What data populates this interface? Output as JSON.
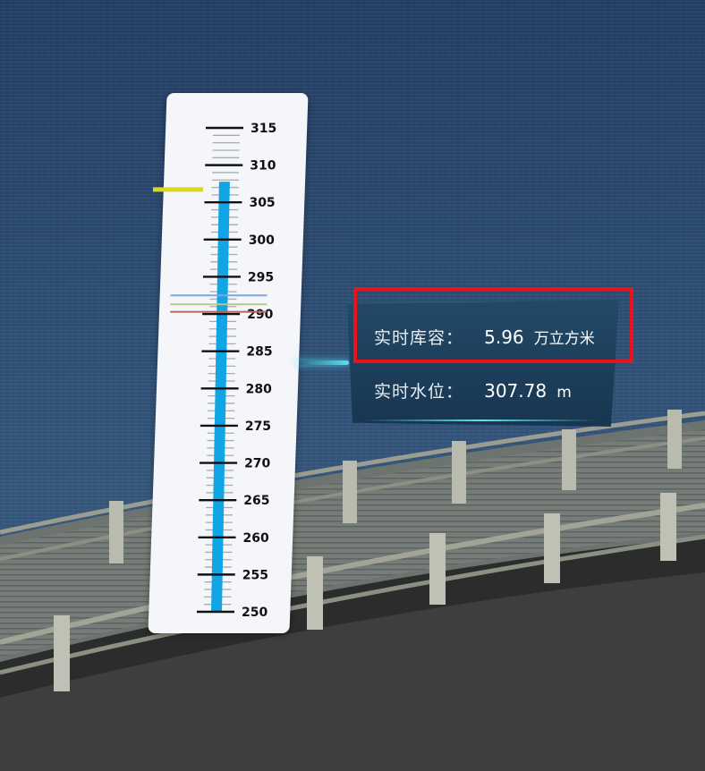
{
  "gauge": {
    "ticks": [
      "315",
      "310",
      "305",
      "300",
      "295",
      "290",
      "285",
      "280",
      "275",
      "270",
      "265",
      "260",
      "255",
      "250"
    ],
    "min": 250,
    "max": 315,
    "water_level": 307.78,
    "marker_lines": [
      {
        "value": 307.2,
        "color": "#d8d81c"
      },
      {
        "value": 292.5,
        "color": "#7fa8d8"
      },
      {
        "value": 291.3,
        "color": "#b8c78a"
      },
      {
        "value": 290.3,
        "color": "#c06060"
      }
    ],
    "fill_color": "#10a6e6"
  },
  "info": {
    "capacity_label": "实时库容：",
    "capacity_value": "5.96",
    "capacity_unit": "万立方米",
    "level_label": "实时水位：",
    "level_value": "307.78",
    "level_unit": "m"
  }
}
